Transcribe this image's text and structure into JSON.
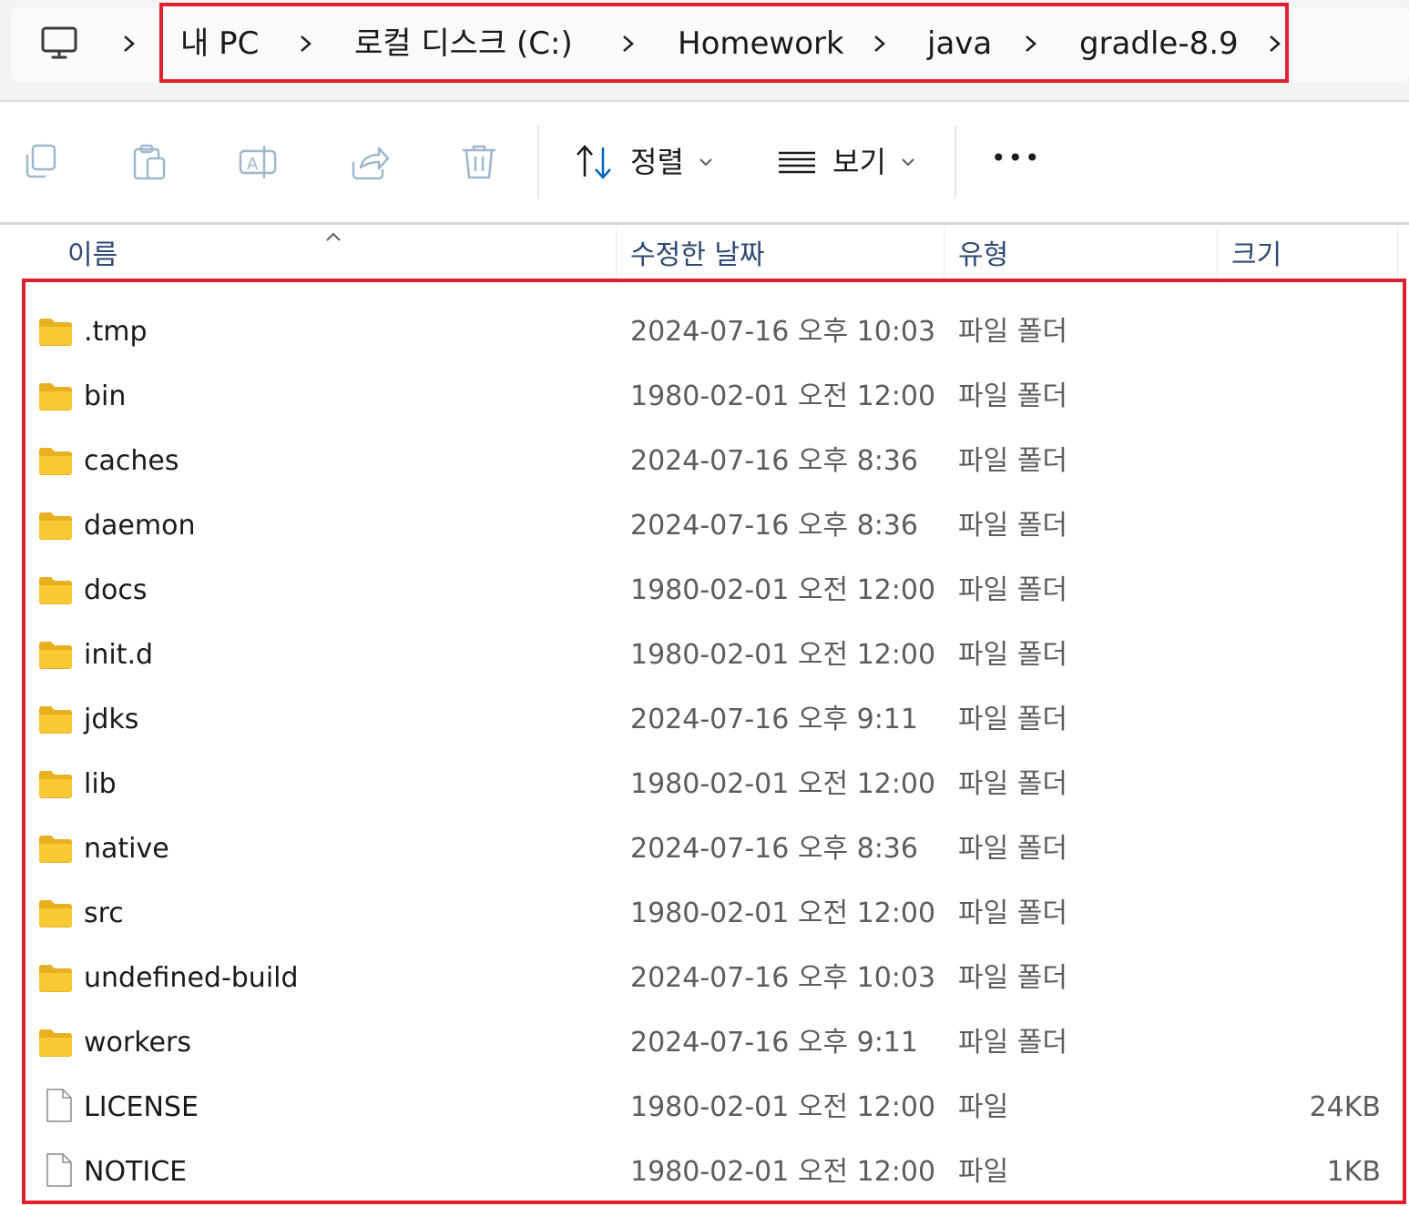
{
  "breadcrumb": {
    "items": [
      "내 PC",
      "로컬 디스크 (C:)",
      "Homework",
      "java",
      "gradle-8.9"
    ]
  },
  "toolbar": {
    "sort_label": "정렬",
    "view_label": "보기",
    "more_label": "•••"
  },
  "columns": {
    "name": "이름",
    "modified": "수정한 날짜",
    "type": "유형",
    "size": "크기"
  },
  "files": [
    {
      "name": ".tmp",
      "modified": "2024-07-16 오후 10:03",
      "type": "파일 폴더",
      "size": "",
      "kind": "folder"
    },
    {
      "name": "bin",
      "modified": "1980-02-01 오전 12:00",
      "type": "파일 폴더",
      "size": "",
      "kind": "folder"
    },
    {
      "name": "caches",
      "modified": "2024-07-16 오후 8:36",
      "type": "파일 폴더",
      "size": "",
      "kind": "folder"
    },
    {
      "name": "daemon",
      "modified": "2024-07-16 오후 8:36",
      "type": "파일 폴더",
      "size": "",
      "kind": "folder"
    },
    {
      "name": "docs",
      "modified": "1980-02-01 오전 12:00",
      "type": "파일 폴더",
      "size": "",
      "kind": "folder"
    },
    {
      "name": "init.d",
      "modified": "1980-02-01 오전 12:00",
      "type": "파일 폴더",
      "size": "",
      "kind": "folder"
    },
    {
      "name": "jdks",
      "modified": "2024-07-16 오후 9:11",
      "type": "파일 폴더",
      "size": "",
      "kind": "folder"
    },
    {
      "name": "lib",
      "modified": "1980-02-01 오전 12:00",
      "type": "파일 폴더",
      "size": "",
      "kind": "folder"
    },
    {
      "name": "native",
      "modified": "2024-07-16 오후 8:36",
      "type": "파일 폴더",
      "size": "",
      "kind": "folder"
    },
    {
      "name": "src",
      "modified": "1980-02-01 오전 12:00",
      "type": "파일 폴더",
      "size": "",
      "kind": "folder"
    },
    {
      "name": "undefined-build",
      "modified": "2024-07-16 오후 10:03",
      "type": "파일 폴더",
      "size": "",
      "kind": "folder"
    },
    {
      "name": "workers",
      "modified": "2024-07-16 오후 9:11",
      "type": "파일 폴더",
      "size": "",
      "kind": "folder"
    },
    {
      "name": "LICENSE",
      "modified": "1980-02-01 오전 12:00",
      "type": "파일",
      "size": "24KB",
      "kind": "file"
    },
    {
      "name": "NOTICE",
      "modified": "1980-02-01 오전 12:00",
      "type": "파일",
      "size": "1KB",
      "kind": "file"
    }
  ],
  "colors": {
    "highlight": "#e0202e",
    "folder": "#f8c934",
    "accent": "#0067c0"
  }
}
